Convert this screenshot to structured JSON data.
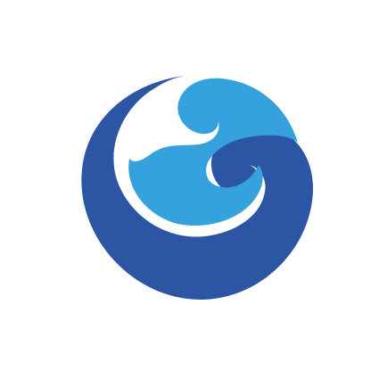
{
  "emblem": {
    "icon": "wave-circle-logo-icon",
    "colors": {
      "background": "#ffffff",
      "outer_circle": "#2c55a4",
      "inner_wave": "#35a2dd"
    }
  }
}
